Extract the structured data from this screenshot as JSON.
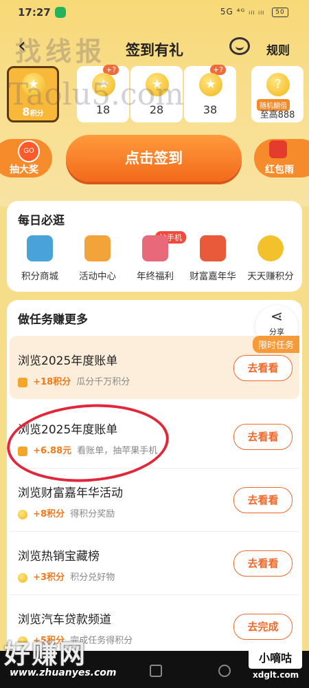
{
  "status_bar": {
    "time": "17:27",
    "indicators": "5G ⁴ᴳ ᵢₗₗ ᵢₗₗ",
    "battery": "50"
  },
  "header": {
    "title": "签到有礼",
    "rules": "规则"
  },
  "watermarks": {
    "top": "找线报",
    "middle": "Taolu5.com",
    "bottom": "好赚网",
    "bottom_url": "www.zhuanyes.com",
    "bottom_right": "小嘀咕",
    "bottom_right_url": "xdglt.com"
  },
  "days": [
    {
      "num": "8",
      "suffix": "积分",
      "current": true
    },
    {
      "num": "18",
      "badge": "+"
    },
    {
      "num": "28"
    },
    {
      "num": "38",
      "badge": "+"
    },
    {
      "tag": "随机翻倍",
      "num": "至高888"
    }
  ],
  "actions": {
    "lottery": "抽大奖",
    "lottery_icon_text": "GO",
    "checkin": "点击签到",
    "red_rain": "红包雨"
  },
  "daily": {
    "title": "每日必逛",
    "hot_badge": "抽手机",
    "items": [
      {
        "label": "积分商城",
        "color": "#4aa3d8"
      },
      {
        "label": "活动中心",
        "color": "#f2a33a"
      },
      {
        "label": "年终福利",
        "color": "#e86a7a"
      },
      {
        "label": "财富嘉年华",
        "color": "#e85a3a"
      },
      {
        "label": "天天赚积分",
        "color": "#f3c12c"
      }
    ]
  },
  "tasks": {
    "title": "做任务赚更多",
    "share": "分享",
    "limited": "限时任务",
    "list": [
      {
        "name": "浏览2025年度账单",
        "amount": "+18积分",
        "desc": "瓜分千万积分",
        "button": "去看看"
      },
      {
        "name": "浏览2025年度账单",
        "amount": "+6.88元",
        "desc": "看账单，抽苹果手机",
        "button": "去看看"
      },
      {
        "name": "浏览财富嘉年华活动",
        "amount": "+8积分",
        "desc": "得积分奖励",
        "button": "去看看"
      },
      {
        "name": "浏览热销宝藏榜",
        "amount": "+3积分",
        "desc": "积分兑好物",
        "button": "去看看"
      },
      {
        "name": "浏览汽车贷款频道",
        "amount": "+5积分",
        "desc": "完成任务得积分",
        "button": "去完成"
      }
    ]
  }
}
